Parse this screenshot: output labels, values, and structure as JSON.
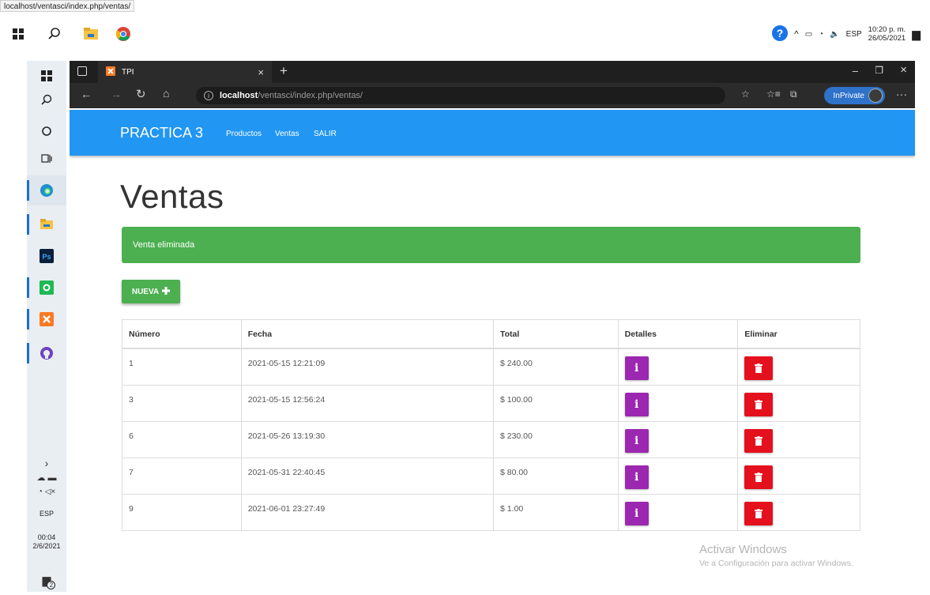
{
  "tooltip_url": "localhost/ventasci/index.php/ventas/",
  "outer_tray": {
    "lang": "ESP",
    "time": "10:20 p. m.",
    "date": "26/05/2021"
  },
  "inner_taskbar": {
    "lang": "ESP",
    "time": "00:04",
    "date": "2/6/2021",
    "notif_count": "2"
  },
  "browser": {
    "tab_title": "TPI",
    "url_host": "localhost",
    "url_path": "/ventasci/index.php/ventas/",
    "inprivate_label": "InPrivate"
  },
  "navbar": {
    "brand": "PRACTICA 3",
    "links": [
      "Productos",
      "Ventas",
      "SALIR"
    ]
  },
  "page": {
    "title": "Ventas",
    "alert": "Venta eliminada",
    "new_button": "NUEVA"
  },
  "table": {
    "headers": [
      "Número",
      "Fecha",
      "Total",
      "Detalles",
      "Eliminar"
    ],
    "rows": [
      {
        "numero": "1",
        "fecha": "2021-05-15 12:21:09",
        "total": "$ 240.00"
      },
      {
        "numero": "3",
        "fecha": "2021-05-15 12:56:24",
        "total": "$ 100.00"
      },
      {
        "numero": "6",
        "fecha": "2021-05-26 13:19:30",
        "total": "$ 230.00"
      },
      {
        "numero": "7",
        "fecha": "2021-05-31 22:40:45",
        "total": "$ 80.00"
      },
      {
        "numero": "9",
        "fecha": "2021-06-01 23:27:49",
        "total": "$ 1.00"
      }
    ]
  },
  "watermark": {
    "title": "Activar Windows",
    "subtitle": "Ve a Configuración para activar Windows."
  },
  "colors": {
    "navbar": "#2196f3",
    "success": "#4caf50",
    "info": "#9c27b0",
    "danger": "#e5101d"
  }
}
